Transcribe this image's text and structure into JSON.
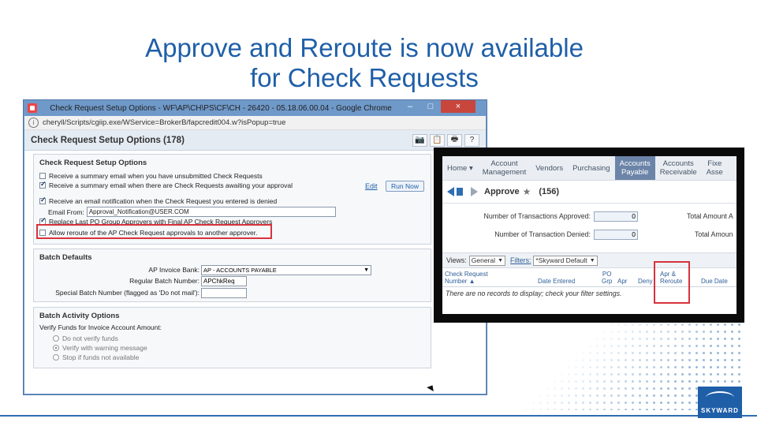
{
  "slide": {
    "title_line1": "Approve and Reroute is now available",
    "title_line2": "for Check Requests",
    "logo_text": "SKYWARD",
    "colors": {
      "title": "#1f5fa8",
      "highlight": "#d7333c"
    }
  },
  "window": {
    "title": "Check Request Setup Options - WF\\AP\\CH\\PS\\CF\\CH - 26420 - 05.18.06.00.04 - Google Chrome",
    "controls": {
      "minimize": "–",
      "maximize": "□",
      "close": "×"
    },
    "url": "cheryll/Scripts/cgiip.exe/WService=BrokerB/fapcredit004.w?isPopup=true"
  },
  "page": {
    "title": "Check Request Setup Options (178)",
    "toolbar_icons": [
      "camera-icon",
      "notes-icon",
      "print-icon",
      "help-icon"
    ],
    "toolbar_glyphs": [
      "📷",
      "📋",
      "🖶",
      "?"
    ],
    "setup": {
      "heading": "Check Request Setup Options",
      "opt_unsubmitted": "Receive a summary email when you have unsubmitted Check Requests",
      "opt_awaiting": "Receive a summary email when there are Check Requests awaiting your approval",
      "edit_link": "Edit",
      "run_now": "Run Now",
      "opt_denied": "Receive an email notification when the Check Request you entered is denied",
      "email_from_label": "Email From:",
      "email_from_value": "Approval_Notification@USER.COM",
      "opt_replace": "Replace Last PO Group Approvers with Final AP Check Request Approvers",
      "opt_reroute": "Allow reroute of the AP Check Request approvals to another approver."
    },
    "batch": {
      "heading": "Batch Defaults",
      "invoice_bank_label": "AP Invoice Bank:",
      "invoice_bank_value": "AP      -  ACCOUNTS  PAYABLE",
      "regular_batch_label": "Regular Batch Number:",
      "regular_batch_value": "APChkReq",
      "special_batch_label": "Special Batch Number (flagged as 'Do not mail'):",
      "special_batch_value": ""
    },
    "activity": {
      "heading": "Batch Activity Options",
      "verify_label": "Verify Funds for Invoice Account Amount:",
      "opt_none": "Do not verify funds",
      "opt_warn": "Verify with warning message",
      "opt_stop": "Stop if funds not available"
    }
  },
  "approve": {
    "menu": {
      "home": "Home",
      "account_mgmt_1": "Account",
      "account_mgmt_2": "Management",
      "vendors": "Vendors",
      "purchasing": "Purchasing",
      "ap_1": "Accounts",
      "ap_2": "Payable",
      "ar_1": "Accounts",
      "ar_2": "Receivable",
      "fixed_1": "Fixe",
      "fixed_2": "Asse"
    },
    "title": "Approve",
    "count": "(156)",
    "approved_label": "Number of Transactions Approved:",
    "approved_value": "0",
    "denied_label": "Number of Transaction Denied:",
    "denied_value": "0",
    "total_amount_1": "Total Amount A",
    "total_amount_2": "Total Amoun",
    "views_label": "Views:",
    "views_value": "General",
    "filters_label": "Filters:",
    "filters_value": "*Skyward Default",
    "grid": {
      "check_request_1": "Check Request",
      "check_request_2": "Number ▲",
      "date_entered": "Date Entered",
      "po_1": "PO",
      "po_2": "Grp",
      "apr": "Apr",
      "deny": "Deny",
      "apr_reroute_1": "Apr &",
      "apr_reroute_2": "Reroute",
      "due_date": "Due Date"
    },
    "empty_message": "There are no records to display; check your filter settings."
  }
}
